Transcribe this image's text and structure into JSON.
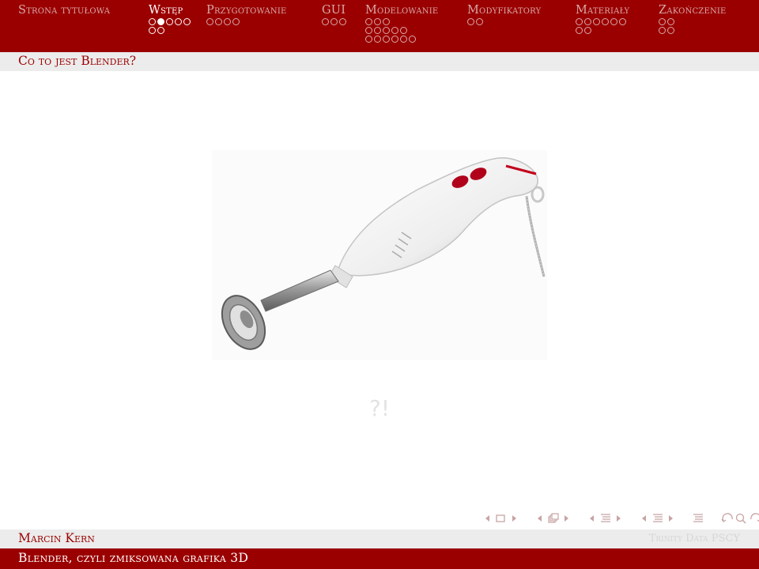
{
  "header": {
    "sections": [
      {
        "title": "Strona tytułowa",
        "active": false,
        "dot_rows": []
      },
      {
        "title": "Wstęp",
        "active": true,
        "dot_rows": [
          [
            0,
            1,
            0,
            0,
            0
          ],
          [
            0,
            0
          ]
        ]
      },
      {
        "title": "Przygotowanie",
        "active": false,
        "dot_rows": [
          [
            0,
            0,
            0,
            0
          ]
        ]
      },
      {
        "title": "GUI",
        "active": false,
        "dot_rows": [
          [
            0,
            0,
            0
          ]
        ]
      },
      {
        "title": "Modelowanie",
        "active": false,
        "dot_rows": [
          [
            0,
            0,
            0
          ],
          [
            0,
            0,
            0,
            0,
            0
          ],
          [
            0,
            0,
            0,
            0,
            0,
            0
          ]
        ]
      },
      {
        "title": "Modyfikatory",
        "active": false,
        "dot_rows": [
          [
            0,
            0
          ]
        ]
      },
      {
        "title": "Materiały",
        "active": false,
        "dot_rows": [
          [
            0,
            0,
            0,
            0,
            0,
            0
          ],
          [
            0,
            0
          ]
        ]
      },
      {
        "title": "Zakończenie",
        "active": false,
        "dot_rows": [
          [
            0,
            0
          ],
          [
            0,
            0
          ]
        ]
      }
    ]
  },
  "frame": {
    "title": "Co to jest Blender?"
  },
  "content": {
    "image_alt": "hand-blender-photo",
    "exclaim": "?!"
  },
  "nav_symbols": [
    "slide-nav-icon",
    "frame-nav-icon",
    "subsection-nav-icon",
    "section-nav-icon",
    "document-nav-icon",
    "search-navigation-icon"
  ],
  "footer": {
    "author": "Marcin Kern",
    "faint_text": "Trinity Data PSCY",
    "title": "Blender, czyli zmiksowana grafika 3D"
  },
  "colors": {
    "primary": "#9b0000",
    "faint": "#d8a9a9",
    "bar_gray": "#ececec"
  }
}
